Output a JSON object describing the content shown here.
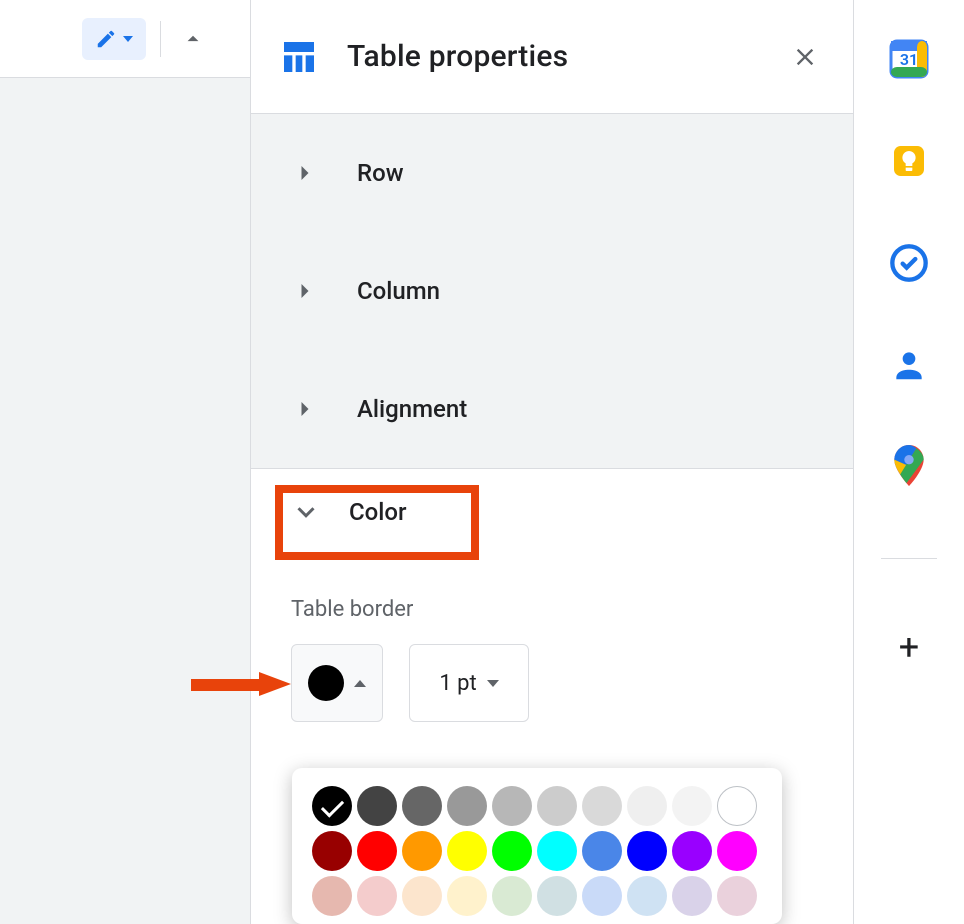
{
  "panel": {
    "title": "Table properties",
    "sections": {
      "row": "Row",
      "column": "Column",
      "alignment": "Alignment",
      "color": "Color"
    },
    "tableBorder": {
      "label": "Table border",
      "currentColor": "#000000",
      "width": "1 pt"
    }
  },
  "colorPopover": {
    "rows": [
      [
        {
          "hex": "#000000",
          "selected": true
        },
        {
          "hex": "#434343"
        },
        {
          "hex": "#666666"
        },
        {
          "hex": "#999999"
        },
        {
          "hex": "#b7b7b7"
        },
        {
          "hex": "#cccccc"
        },
        {
          "hex": "#d9d9d9"
        },
        {
          "hex": "#efefef"
        },
        {
          "hex": "#f3f3f3"
        },
        {
          "hex": "#ffffff",
          "stroke": true
        }
      ],
      [
        {
          "hex": "#980000"
        },
        {
          "hex": "#ff0000"
        },
        {
          "hex": "#ff9900"
        },
        {
          "hex": "#ffff00"
        },
        {
          "hex": "#00ff00"
        },
        {
          "hex": "#00ffff"
        },
        {
          "hex": "#4a86e8"
        },
        {
          "hex": "#0000ff"
        },
        {
          "hex": "#9900ff"
        },
        {
          "hex": "#ff00ff"
        }
      ],
      [
        {
          "hex": "#e6b8af"
        },
        {
          "hex": "#f4cccc"
        },
        {
          "hex": "#fce5cd"
        },
        {
          "hex": "#fff2cc"
        },
        {
          "hex": "#d9ead3"
        },
        {
          "hex": "#d0e0e3"
        },
        {
          "hex": "#c9daf8"
        },
        {
          "hex": "#cfe2f3"
        },
        {
          "hex": "#d9d2e9"
        },
        {
          "hex": "#ead1dc"
        }
      ]
    ]
  },
  "sidebar": {
    "calendarDay": "31"
  }
}
